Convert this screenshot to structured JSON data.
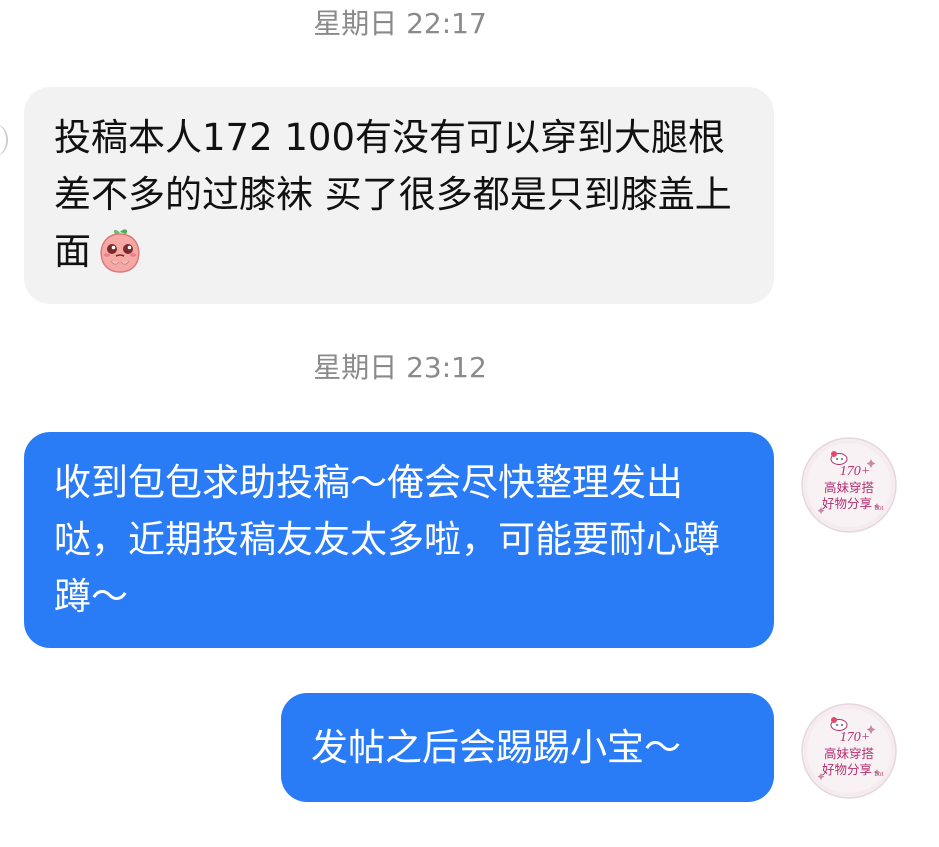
{
  "chat": {
    "messages": [
      {
        "timestamp": "星期日 22:17",
        "direction": "incoming",
        "text": "投稿本人172 100有没有可以穿到大腿根差不多的过膝袜 买了很多都是只到膝盖上面",
        "emoji": "crying-peach-emoji"
      },
      {
        "timestamp": "星期日 23:12",
        "direction": "outgoing",
        "text": "收到包包求助投稿～俺会尽快整理发出哒，近期投稿友友太多啦，可能要耐心蹲蹲～",
        "avatar_text": {
          "line1": "170+",
          "line2": "高妹穿搭",
          "line3": "好物分享",
          "suffix": "bot"
        }
      },
      {
        "direction": "outgoing",
        "text": "发帖之后会踢踢小宝～",
        "avatar_text": {
          "line1": "170+",
          "line2": "高妹穿搭",
          "line3": "好物分享",
          "suffix": "bot"
        }
      }
    ]
  },
  "colors": {
    "outgoing_bubble": "#2a7cf6",
    "incoming_bubble": "#f2f2f3",
    "timestamp_text": "#8a8a8a",
    "avatar_text": "#b0306e"
  }
}
